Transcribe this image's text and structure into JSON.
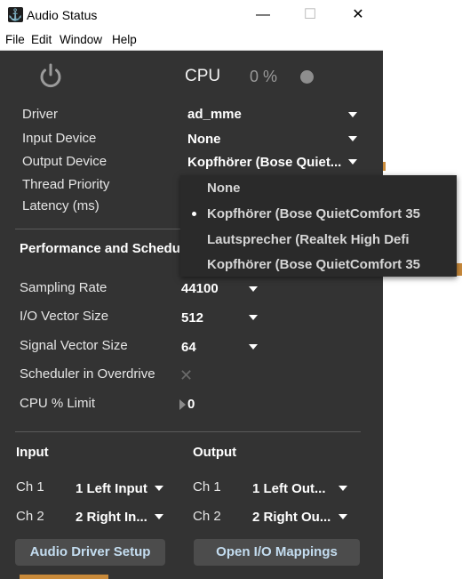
{
  "window": {
    "title": "Audio Status",
    "minimize_glyph": "—",
    "maximize_glyph": "☐",
    "close_glyph": "✕",
    "icon": "app-icon"
  },
  "menu": [
    "File",
    "Edit",
    "Window",
    "Help"
  ],
  "status": {
    "cpu_label": "CPU",
    "cpu_value": "0 %",
    "power_icon": "power-icon",
    "indicator": "status-dot"
  },
  "device": {
    "driver_label": "Driver",
    "driver_value": "ad_mme",
    "input_label": "Input Device",
    "input_value": "None",
    "output_label": "Output Device",
    "output_value": "Kopfhörer (Bose Quiet...",
    "thread_label": "Thread Priority",
    "latency_label": "Latency (ms)"
  },
  "output_menu": {
    "options": [
      "None",
      "Kopfhörer (Bose QuietComfort 35",
      "Lautsprecher (Realtek High Defi",
      "Kopfhörer (Bose QuietComfort 35"
    ],
    "selected_index": 1
  },
  "performance": {
    "heading": "Performance and Schedu",
    "sampling_label": "Sampling Rate",
    "sampling_value": "44100",
    "io_label": "I/O Vector Size",
    "io_value": "512",
    "signal_label": "Signal Vector Size",
    "signal_value": "64",
    "overdrive_label": "Scheduler in Overdrive",
    "overdrive_glyph": "✕",
    "cpu_limit_label": "CPU % Limit",
    "cpu_limit_value": "0"
  },
  "io": {
    "input_heading": "Input",
    "output_heading": "Output",
    "in_ch1_label": "Ch 1",
    "in_ch1_value": "1 Left Input",
    "in_ch2_label": "Ch 2",
    "in_ch2_value": "2 Right In...",
    "out_ch1_label": "Ch 1",
    "out_ch1_value": "1 Left Out...",
    "out_ch2_label": "Ch 2",
    "out_ch2_value": "2 Right Ou..."
  },
  "buttons": {
    "driver_setup": "Audio Driver Setup",
    "io_mappings": "Open I/O Mappings"
  },
  "colors": {
    "panel": "#333333",
    "button_text": "#c4ddf0",
    "accent": "#c98a3a"
  }
}
